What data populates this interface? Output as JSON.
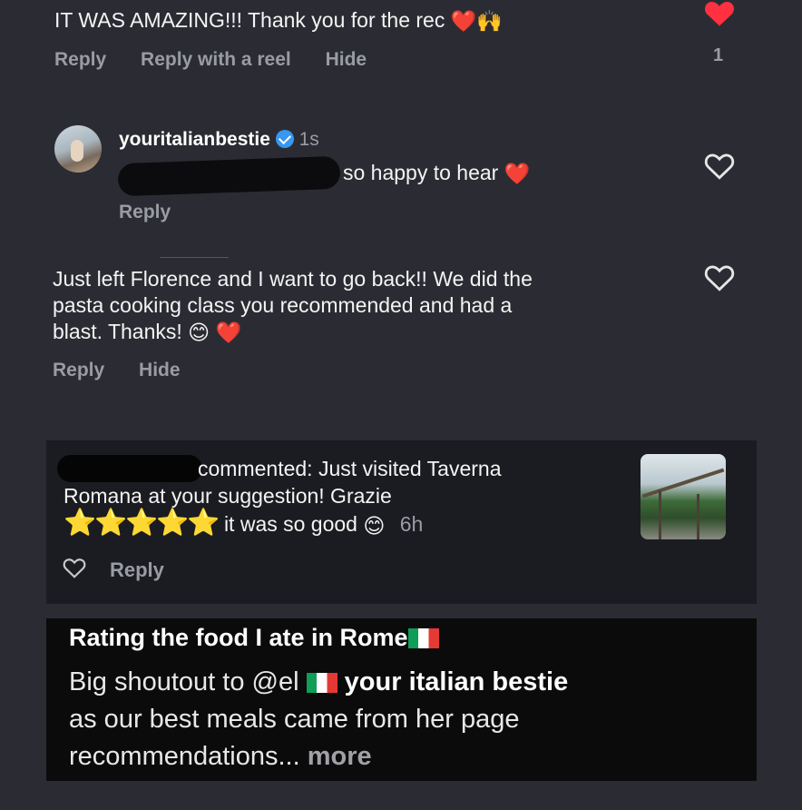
{
  "comment1": {
    "text": "IT WAS AMAZING!!! Thank you for the rec",
    "emojis": "❤️🙌",
    "actions": [
      "Reply",
      "Reply with a reel",
      "Hide"
    ],
    "like_count": "1"
  },
  "reply1": {
    "username": "youritalianbestie",
    "time": "1s",
    "text": "so happy to hear",
    "emoji": "❤️",
    "action": "Reply"
  },
  "comment2": {
    "text_line1": "Just left Florence and I want to go back!! We did the",
    "text_line2": "pasta cooking class you recommended and had a",
    "text_line3": "blast. Thanks!",
    "emojis": "😊 ❤️",
    "actions": [
      "Reply",
      "Hide"
    ]
  },
  "notification": {
    "line1": "commented: Just visited Taverna",
    "line2": "Romana at your suggestion!  Grazie",
    "stars": "⭐⭐⭐⭐⭐",
    "line3": "it was so good",
    "emoji": "😊",
    "time": "6h",
    "action": "Reply"
  },
  "reel": {
    "title": "Rating the food I ate in Rome",
    "line1_a": "Big shoutout to @el",
    "line1_b": "your italian bestie",
    "line2": "as our best meals came from her page",
    "line3": "recommendations...",
    "more": "more"
  },
  "colors": {
    "background": "#2b2c33",
    "like_red": "#ff3040",
    "verified_blue": "#3897f0",
    "secondary_text": "#9a9ca3"
  }
}
